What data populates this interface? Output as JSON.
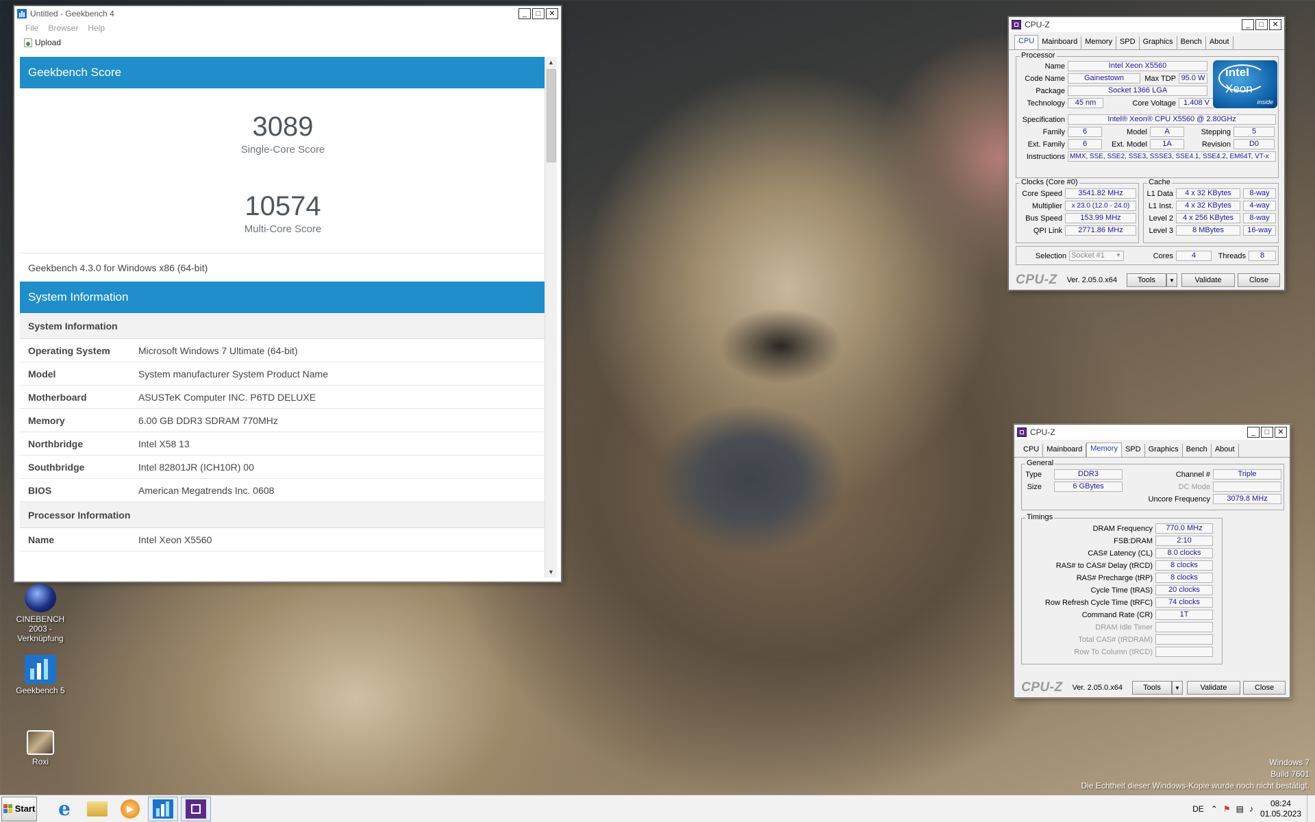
{
  "geekbench": {
    "title": "Untitled - Geekbench 4",
    "menu": [
      "File",
      "Browser",
      "Help"
    ],
    "upload_label": "Upload",
    "score_header": "Geekbench Score",
    "single_score": "3089",
    "single_label": "Single-Core Score",
    "multi_score": "10574",
    "multi_label": "Multi-Core Score",
    "version": "Geekbench 4.3.0 for Windows x86 (64-bit)",
    "sysinfo_header": "System Information",
    "sysinfo_sub": "System Information",
    "rows": [
      {
        "k": "Operating System",
        "v": "Microsoft Windows 7 Ultimate (64-bit)"
      },
      {
        "k": "Model",
        "v": "System manufacturer System Product Name"
      },
      {
        "k": "Motherboard",
        "v": "ASUSTeK Computer INC. P6TD DELUXE"
      },
      {
        "k": "Memory",
        "v": "6.00 GB DDR3 SDRAM 770MHz"
      },
      {
        "k": "Northbridge",
        "v": "Intel X58 13"
      },
      {
        "k": "Southbridge",
        "v": "Intel 82801JR (ICH10R) 00"
      },
      {
        "k": "BIOS",
        "v": "American Megatrends Inc. 0608"
      }
    ],
    "proc_sub": "Processor Information",
    "proc_rows": [
      {
        "k": "Name",
        "v": "Intel Xeon X5560"
      }
    ]
  },
  "cpuz1": {
    "title": "CPU-Z",
    "tabs": [
      "CPU",
      "Mainboard",
      "Memory",
      "SPD",
      "Graphics",
      "Bench",
      "About"
    ],
    "processor_group": "Processor",
    "name_l": "Name",
    "name_v": "Intel Xeon X5560",
    "code_l": "Code Name",
    "code_v": "Gainestown",
    "tdp_l": "Max TDP",
    "tdp_v": "95.0 W",
    "pkg_l": "Package",
    "pkg_v": "Socket 1366 LGA",
    "tech_l": "Technology",
    "tech_v": "45 nm",
    "volt_l": "Core Voltage",
    "volt_v": "1.408 V",
    "spec_l": "Specification",
    "spec_v": "Intel® Xeon® CPU           X5560  @ 2.80GHz",
    "fam_l": "Family",
    "fam_v": "6",
    "model_l": "Model",
    "model_v": "A",
    "step_l": "Stepping",
    "step_v": "5",
    "efam_l": "Ext. Family",
    "efam_v": "6",
    "emod_l": "Ext. Model",
    "emod_v": "1A",
    "rev_l": "Revision",
    "rev_v": "D0",
    "ins_l": "Instructions",
    "ins_v": "MMX, SSE, SSE2, SSE3, SSSE3, SSE4.1, SSE4.2, EM64T, VT-x",
    "clocks_group": "Clocks (Core #0)",
    "cs_l": "Core Speed",
    "cs_v": "3541.82 MHz",
    "mul_l": "Multiplier",
    "mul_v": "x 23.0 (12.0 - 24.0)",
    "bus_l": "Bus Speed",
    "bus_v": "153.99 MHz",
    "qpi_l": "QPI Link",
    "qpi_v": "2771.86 MHz",
    "cache_group": "Cache",
    "l1d_l": "L1 Data",
    "l1d_v": "4 x 32 KBytes",
    "l1d_w": "8-way",
    "l1i_l": "L1 Inst.",
    "l1i_v": "4 x 32 KBytes",
    "l1i_w": "4-way",
    "l2_l": "Level 2",
    "l2_v": "4 x 256 KBytes",
    "l2_w": "8-way",
    "l3_l": "Level 3",
    "l3_v": "8 MBytes",
    "l3_w": "16-way",
    "sel_l": "Selection",
    "sel_v": "Socket #1",
    "cores_l": "Cores",
    "cores_v": "4",
    "threads_l": "Threads",
    "threads_v": "8",
    "intel_1": "intel",
    "intel_2": "Xeon",
    "intel_3": "inside",
    "logo": "CPU-Z",
    "ver": "Ver. 2.05.0.x64",
    "tools": "Tools",
    "validate": "Validate",
    "close": "Close"
  },
  "cpuz2": {
    "title": "CPU-Z",
    "tabs": [
      "CPU",
      "Mainboard",
      "Memory",
      "SPD",
      "Graphics",
      "Bench",
      "About"
    ],
    "general_group": "General",
    "type_l": "Type",
    "type_v": "DDR3",
    "size_l": "Size",
    "size_v": "6 GBytes",
    "chan_l": "Channel #",
    "chan_v": "Triple",
    "dc_l": "DC Mode",
    "dc_v": "",
    "unc_l": "Uncore Frequency",
    "unc_v": "3079.8 MHz",
    "timings_group": "Timings",
    "timings": [
      {
        "l": "DRAM Frequency",
        "v": "770.0 MHz",
        "dim": false
      },
      {
        "l": "FSB:DRAM",
        "v": "2:10",
        "dim": false
      },
      {
        "l": "CAS# Latency (CL)",
        "v": "8.0 clocks",
        "dim": false
      },
      {
        "l": "RAS# to CAS# Delay (tRCD)",
        "v": "8 clocks",
        "dim": false
      },
      {
        "l": "RAS# Precharge (tRP)",
        "v": "8 clocks",
        "dim": false
      },
      {
        "l": "Cycle Time (tRAS)",
        "v": "20 clocks",
        "dim": false
      },
      {
        "l": "Row Refresh Cycle Time (tRFC)",
        "v": "74 clocks",
        "dim": false
      },
      {
        "l": "Command Rate (CR)",
        "v": "1T",
        "dim": false
      },
      {
        "l": "DRAM Idle Timer",
        "v": "",
        "dim": true
      },
      {
        "l": "Total CAS# (tRDRAM)",
        "v": "",
        "dim": true
      },
      {
        "l": "Row To Column (tRCD)",
        "v": "",
        "dim": true
      }
    ],
    "logo": "CPU-Z",
    "ver": "Ver. 2.05.0.x64",
    "tools": "Tools",
    "validate": "Validate",
    "close": "Close"
  },
  "desktop": {
    "icons": [
      {
        "label": "CINEBENCH 2003 - Verknüpfung"
      },
      {
        "label": "Geekbench 5"
      },
      {
        "label": "Roxi"
      }
    ],
    "watermark": [
      "Windows 7",
      "Build 7601",
      "Die Echtheit dieser Windows-Kopie wurde noch nicht bestätigt."
    ]
  },
  "taskbar": {
    "start": "Start",
    "lang": "DE",
    "time": "08:24",
    "date": "01.05.2023"
  },
  "colors": {
    "gb_blue": "#1f8ecb",
    "cpuz_value": "#1616a0"
  }
}
